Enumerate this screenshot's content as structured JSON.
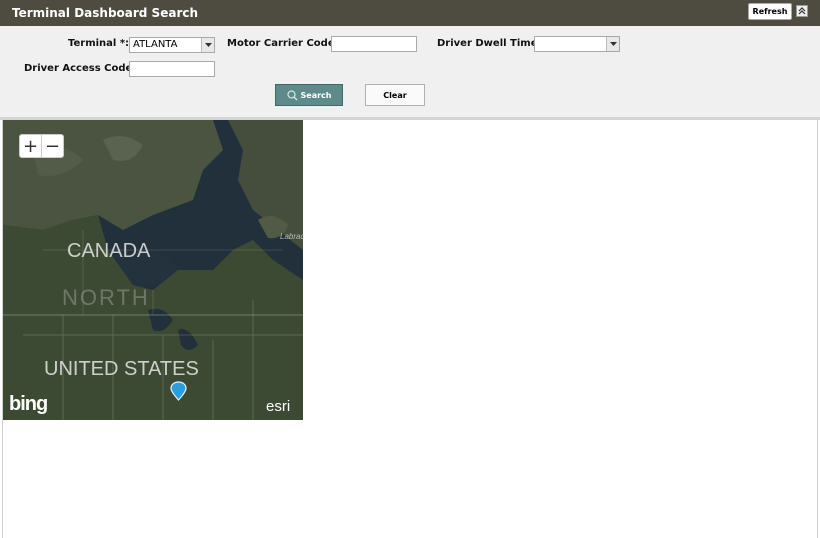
{
  "header": {
    "title": "Terminal Dashboard Search",
    "refresh_label": "Refresh"
  },
  "form": {
    "terminal": {
      "label": "Terminal *:",
      "value": "ATLANTA"
    },
    "motor_carrier_code": {
      "label": "Motor Carrier Code:",
      "value": ""
    },
    "driver_dwell_time": {
      "label": "Driver Dwell Time:",
      "value": ""
    },
    "driver_access_code": {
      "label": "Driver Access Code:",
      "value": ""
    },
    "search_label": "Search",
    "clear_label": "Clear"
  },
  "map": {
    "labels": {
      "canada": "CANADA",
      "north_america": "NORTH",
      "united_states": "UNITED STATES",
      "labrador": "Labrac"
    },
    "attribution": {
      "bing": "bing",
      "esri": "esri"
    },
    "marker_icon": "location-pin-icon",
    "colors": {
      "marker": "#2a9fe0",
      "land": "#3e4a32",
      "water": "#1f2e3c"
    }
  },
  "icons": {
    "collapse": "double-chevron-up-icon",
    "dropdown": "chevron-down-icon",
    "search": "search-icon",
    "zoom_in": "plus-icon",
    "zoom_out": "minus-icon"
  }
}
